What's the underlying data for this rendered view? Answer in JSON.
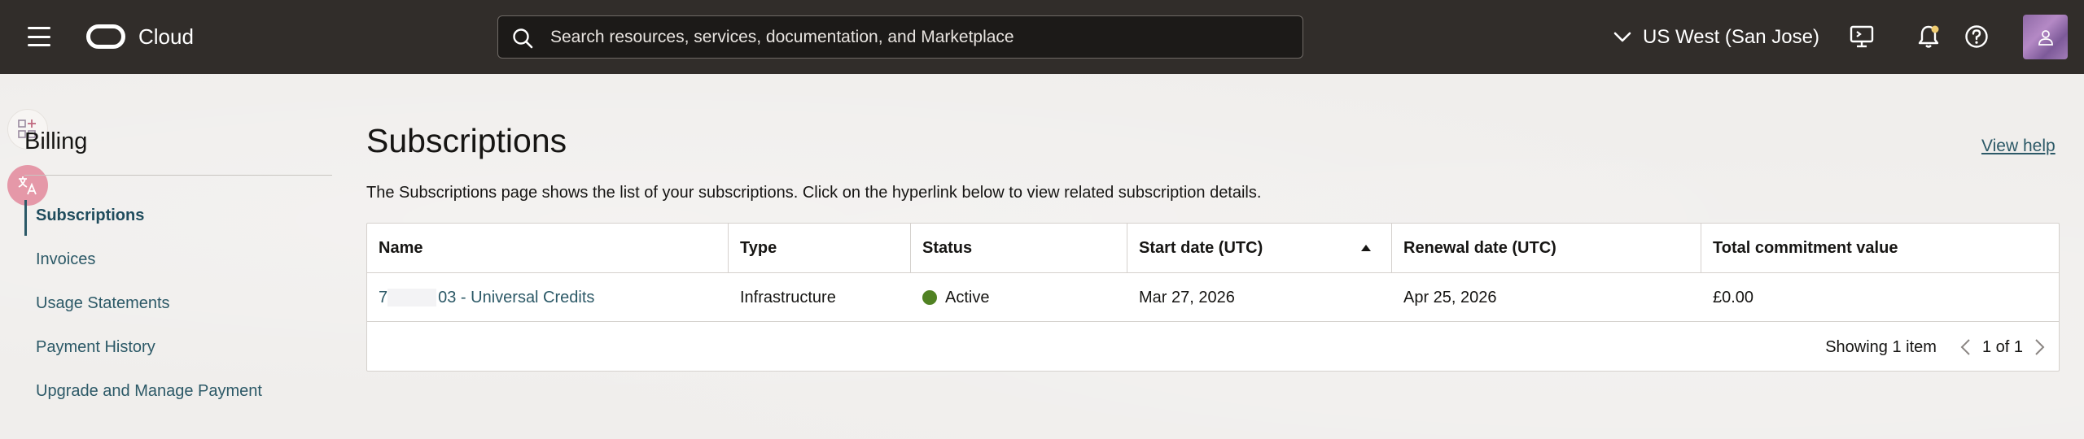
{
  "header": {
    "brand": "Cloud",
    "search_placeholder": "Search resources, services, documentation, and Marketplace",
    "region": "US West (San Jose)"
  },
  "sidebar": {
    "title": "Billing",
    "items": [
      {
        "label": "Subscriptions",
        "active": true
      },
      {
        "label": "Invoices",
        "active": false
      },
      {
        "label": "Usage Statements",
        "active": false
      },
      {
        "label": "Payment History",
        "active": false
      },
      {
        "label": "Upgrade and Manage Payment",
        "active": false
      }
    ]
  },
  "main": {
    "title": "Subscriptions",
    "help_link": "View help",
    "description": "The Subscriptions page shows the list of your subscriptions. Click on the hyperlink below to view related subscription details.",
    "table": {
      "columns": [
        "Name",
        "Type",
        "Status",
        "Start date (UTC)",
        "Renewal date (UTC)",
        "Total commitment value"
      ],
      "rows": [
        {
          "name_prefix": "7",
          "name_suffix": "03 - Universal Credits",
          "type": "Infrastructure",
          "status": "Active",
          "start_date": "Mar 27, 2026",
          "renewal_date": "Apr 25, 2026",
          "total_commitment": "£0.00"
        }
      ],
      "showing": "Showing 1 item",
      "page_indicator": "1 of 1"
    }
  },
  "colors": {
    "header_bg": "#312d2a",
    "link": "#2c5967",
    "status_active": "#508223"
  }
}
